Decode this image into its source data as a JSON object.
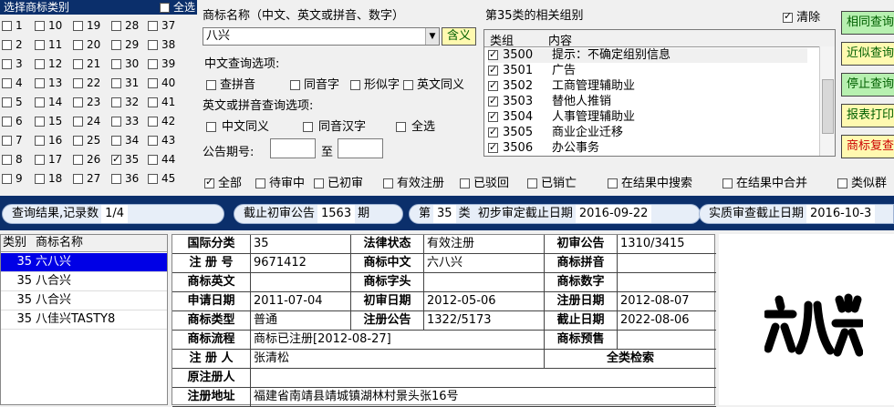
{
  "class_panel": {
    "title": "选择商标类别",
    "select_all": "全选",
    "classes": [
      "1",
      "2",
      "3",
      "4",
      "5",
      "6",
      "7",
      "8",
      "9",
      "10",
      "11",
      "12",
      "13",
      "14",
      "15",
      "16",
      "17",
      "18",
      "19",
      "20",
      "21",
      "22",
      "23",
      "24",
      "25",
      "26",
      "27",
      "28",
      "29",
      "30",
      "31",
      "32",
      "33",
      "34",
      "35",
      "36",
      "37",
      "38",
      "39",
      "40",
      "41",
      "42",
      "43",
      "44",
      "45"
    ],
    "checked": [
      "35"
    ]
  },
  "query": {
    "name_label": "商标名称（中文、英文或拼音、数字）",
    "name_value": "八兴",
    "meaning_button": "含义",
    "cn_options_label": "中文查询选项:",
    "cn_options": [
      "查拼音",
      "同音字",
      "形似字",
      "英文同义"
    ],
    "en_options_label": "英文或拼音查询选项:",
    "en_options": [
      "中文同义",
      "同音汉字",
      "全选"
    ],
    "period_label": "公告期号:",
    "period_to": "至"
  },
  "groups": {
    "title": "第35类的相关组别",
    "clear_label": "清除",
    "head_group": "类组",
    "head_content": "内容",
    "rows": [
      {
        "code": "3500",
        "content": "提示：不确定组别信息"
      },
      {
        "code": "3501",
        "content": "广告"
      },
      {
        "code": "3502",
        "content": "工商管理辅助业"
      },
      {
        "code": "3503",
        "content": "替他人推销"
      },
      {
        "code": "3504",
        "content": "人事管理辅助业"
      },
      {
        "code": "3505",
        "content": "商业企业迁移"
      },
      {
        "code": "3506",
        "content": "办公事务"
      }
    ]
  },
  "side_buttons": [
    {
      "label": "相同查询",
      "color": "#b7f0b0",
      "text": "#006000"
    },
    {
      "label": "近似查询",
      "color": "#fff9b0",
      "text": "#006000"
    },
    {
      "label": "停止查询",
      "color": "#b7f0b0",
      "text": "#006000"
    },
    {
      "label": "报表打印",
      "color": "#fff9b0",
      "text": "#006000"
    },
    {
      "label": "商标复查",
      "color": "#fff9b0",
      "text": "#cc0000"
    }
  ],
  "filters": [
    {
      "label": "全部",
      "checked": true
    },
    {
      "label": "待审中",
      "checked": false
    },
    {
      "label": "已初审",
      "checked": false
    },
    {
      "label": "有效注册",
      "checked": false
    },
    {
      "label": "已驳回",
      "checked": false
    },
    {
      "label": "已销亡",
      "checked": false
    },
    {
      "label": "在结果中搜索",
      "checked": false
    },
    {
      "label": "在结果中合并",
      "checked": false
    },
    {
      "label": "类似群",
      "checked": false
    }
  ],
  "result_bar": {
    "result_label": "查询结果,记录数",
    "result_count": "1/4",
    "cutoff_label": "截止初审公告",
    "cutoff_value": "1563",
    "cutoff_unit": "期",
    "class_prefix": "第",
    "class_value": "35",
    "class_suffix": "类",
    "prelim_label": "初步审定截止日期",
    "prelim_value": "2016-09-22",
    "substantive_label": "实质审查截止日期",
    "substantive_value": "2016-10-3"
  },
  "result_list": {
    "head_class": "类别",
    "head_name": "商标名称",
    "rows": [
      {
        "cls": "35",
        "name": "六八兴",
        "selected": true
      },
      {
        "cls": "35",
        "name": "八合兴",
        "selected": false
      },
      {
        "cls": "35",
        "name": "八合兴",
        "selected": false
      },
      {
        "cls": "35",
        "name": "八佳兴TASTY8",
        "selected": false
      }
    ]
  },
  "detail": {
    "intl_class_label": "国际分类",
    "intl_class": "35",
    "legal_status_label": "法律状态",
    "legal_status": "有效注册",
    "prelim_notice_label": "初审公告",
    "prelim_notice": "1310/3415",
    "reg_no_label": "注 册 号",
    "reg_no": "9671412",
    "name_cn_label": "商标中文",
    "name_cn": "六八兴",
    "pinyin_label": "商标拼音",
    "name_en_label": "商标英文",
    "initials_label": "商标字头",
    "digits_label": "商标数字",
    "apply_date_label": "申请日期",
    "apply_date": "2011-07-04",
    "prelim_date_label": "初审日期",
    "prelim_date": "2012-05-06",
    "reg_date_label": "注册日期",
    "reg_date": "2012-08-07",
    "type_label": "商标类型",
    "type": "普通",
    "reg_notice_label": "注册公告",
    "reg_notice": "1322/5173",
    "expiry_label": "截止日期",
    "expiry": "2022-08-06",
    "flow_label": "商标流程",
    "flow": "商标已注册[2012-08-27]",
    "alert_label": "商标预售",
    "registrant_label": "注 册 人",
    "registrant": "张清松",
    "search_all": "全类检索",
    "orig_registrant_label": "原注册人",
    "address_label": "注册地址",
    "address": "福建省南靖县靖城镇湖林村景头张16号"
  },
  "logo": {
    "text": "六八兴"
  }
}
